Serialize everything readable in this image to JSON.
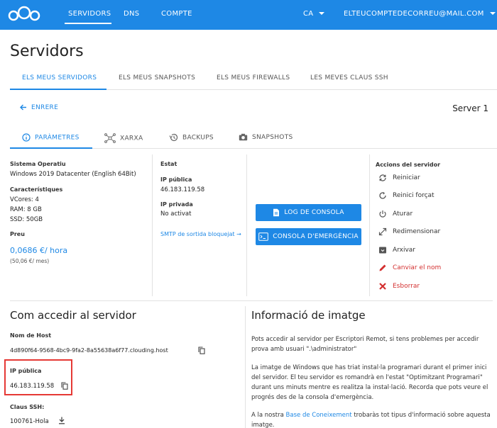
{
  "topbar": {
    "nav": [
      "SERVIDORS",
      "DNS",
      "COMPTE"
    ],
    "lang": "CA",
    "account": "ELTEUCOMPTEDECORREU@MAIL.COM"
  },
  "page": {
    "title": "Servidors"
  },
  "tabs": [
    "ELS MEUS SERVIDORS",
    "ELS MEUS SNAPSHOTS",
    "ELS MEUS FIREWALLS",
    "LES MEVES CLAUS SSH"
  ],
  "back_label": "ENRERE",
  "server_name": "Server 1",
  "subtabs": [
    "PARÀMETRES",
    "XARXA",
    "BACKUPS",
    "SNAPSHOTS"
  ],
  "params": {
    "os_label": "Sistema Operatiu",
    "os_value": "Windows 2019 Datacenter (English 64Bit)",
    "features_label": "Característiques",
    "vcores": "VCores: 4",
    "ram": "RAM: 8 GB",
    "ssd": "SSD: 50GB",
    "price_label": "Preu",
    "price_value": "0,0686 €/ hora",
    "price_month": "(50,06 €/ mes)"
  },
  "status": {
    "state_label": "Estat",
    "public_ip_label": "IP pública",
    "public_ip": "46.183.119.58",
    "private_ip_label": "IP privada",
    "private_ip": "No activat",
    "smtp_link": "SMTP de sortida bloquejat →"
  },
  "console": {
    "log_button": "LOG DE CONSOLA",
    "emergency_button": "CONSOLA D'EMERGÈNCIA"
  },
  "actions": {
    "title": "Accions del servidor",
    "items": [
      {
        "label": "Reiniciar",
        "icon": "restart-icon"
      },
      {
        "label": "Reinici forçat",
        "icon": "force-restart-icon"
      },
      {
        "label": "Aturar",
        "icon": "power-icon"
      },
      {
        "label": "Redimensionar",
        "icon": "resize-icon"
      },
      {
        "label": "Arxivar",
        "icon": "archive-icon"
      },
      {
        "label": "Canviar el nom",
        "icon": "pencil-icon"
      },
      {
        "label": "Esborrar",
        "icon": "delete-icon"
      }
    ]
  },
  "access": {
    "title": "Com accedir al servidor",
    "host_label": "Nom de Host",
    "host_value": "4d890f64-9568-4bc9-9fa2-8a55638a6f77.clouding.host",
    "ip_label": "IP pública",
    "ip_value": "46.183.119.58",
    "ssh_label": "Claus SSH:",
    "ssh_value": "100761-Hola"
  },
  "image_info": {
    "title": "Informació de imatge",
    "p1": "Pots accedir al servidor per Escriptori Remot, si tens problemes per accedir prova amb usuari \".\\administrator\"",
    "p2": "La imatge de Windows que has triat instal·la programari durant el primer inici del servidor. El teu servidor es romandrà en l'estat \"Optimitzant Programari\" durant uns minuts mentre es realitza la instal·lació. Recorda que pots veure el progrés des de la consola d'emergència.",
    "p3_before": "A la nostra ",
    "p3_link": "Base de Coneixement",
    "p3_after": " trobaràs tot tipus d'informació sobre aquesta imatge."
  },
  "colors": {
    "accent": "#1e88e5",
    "danger": "#d32f2f",
    "highlight": "#e53935"
  }
}
